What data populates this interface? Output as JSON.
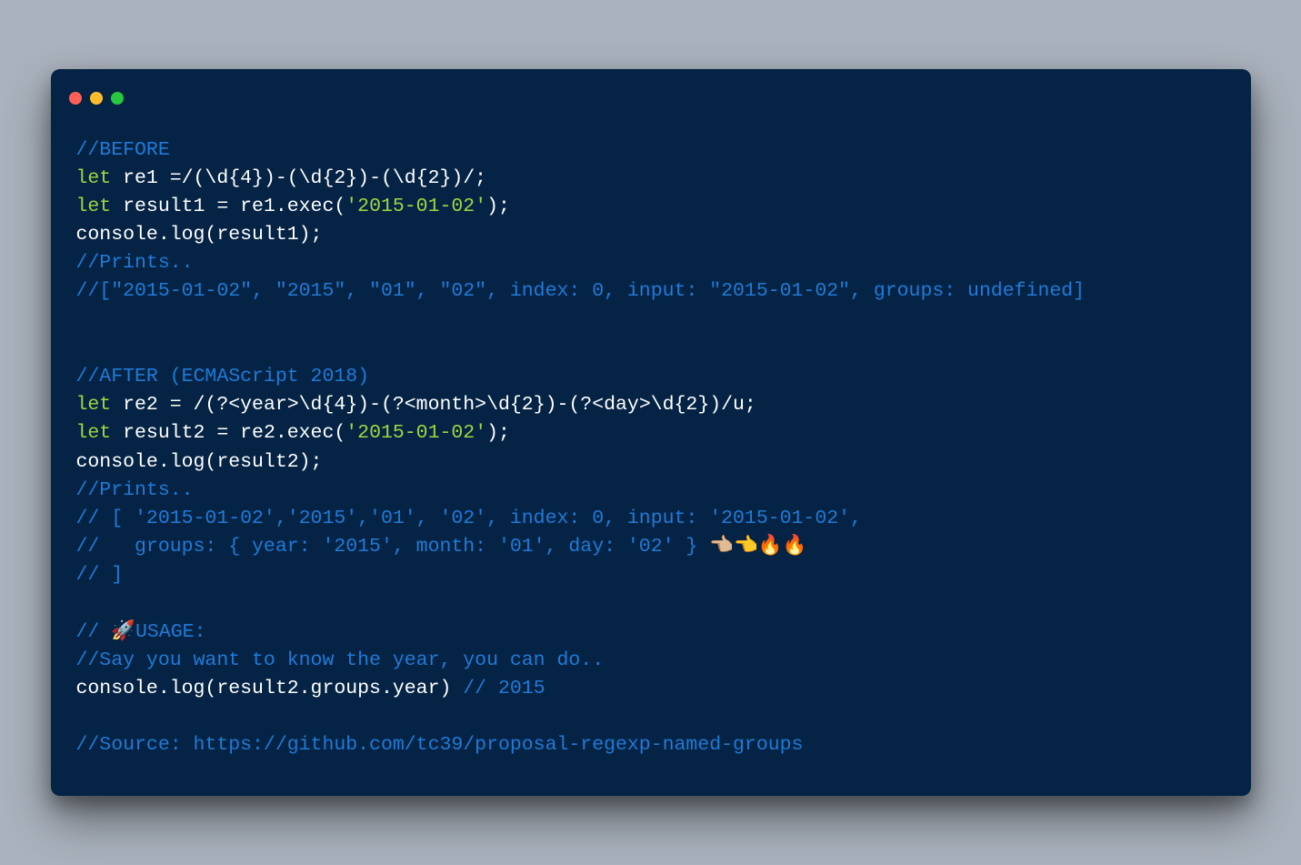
{
  "colors": {
    "background": "#aab2bd",
    "window": "#052445",
    "comment": "#1f7bd8",
    "keyword": "#9fd640",
    "string": "#9fd640",
    "plain": "#ffffff"
  },
  "traffic_lights": [
    "red",
    "yellow",
    "green"
  ],
  "code": {
    "lines": [
      [
        {
          "cls": "comment",
          "text": "//BEFORE"
        }
      ],
      [
        {
          "cls": "keyword",
          "text": "let"
        },
        {
          "cls": "plain",
          "text": " re1 =/(\\d{4})-(\\d{2})-(\\d{2})/;"
        }
      ],
      [
        {
          "cls": "keyword",
          "text": "let"
        },
        {
          "cls": "plain",
          "text": " result1 = re1.exec("
        },
        {
          "cls": "string",
          "text": "'2015-01-02'"
        },
        {
          "cls": "plain",
          "text": ");"
        }
      ],
      [
        {
          "cls": "plain",
          "text": "console.log(result1);"
        }
      ],
      [
        {
          "cls": "comment",
          "text": "//Prints.."
        }
      ],
      [
        {
          "cls": "comment",
          "text": "//[\"2015-01-02\", \"2015\", \"01\", \"02\", index: 0, input: \"2015-01-02\", groups: undefined]"
        }
      ],
      [
        {
          "cls": "plain",
          "text": ""
        }
      ],
      [
        {
          "cls": "plain",
          "text": ""
        }
      ],
      [
        {
          "cls": "comment",
          "text": "//AFTER (ECMAScript 2018)"
        }
      ],
      [
        {
          "cls": "keyword",
          "text": "let"
        },
        {
          "cls": "plain",
          "text": " re2 = /(?<year>\\d{4})-(?<month>\\d{2})-(?<day>\\d{2})/u;"
        }
      ],
      [
        {
          "cls": "keyword",
          "text": "let"
        },
        {
          "cls": "plain",
          "text": " result2 = re2.exec("
        },
        {
          "cls": "string",
          "text": "'2015-01-02'"
        },
        {
          "cls": "plain",
          "text": ");"
        }
      ],
      [
        {
          "cls": "plain",
          "text": "console.log(result2);"
        }
      ],
      [
        {
          "cls": "comment",
          "text": "//Prints.."
        }
      ],
      [
        {
          "cls": "comment",
          "text": "// [ '2015-01-02','2015','01', '02', index: 0, input: '2015-01-02',"
        }
      ],
      [
        {
          "cls": "comment",
          "text": "//   groups: { year: '2015', month: '01', day: '02' } "
        },
        {
          "cls": "plain",
          "text": "👈🏼👈🔥🔥"
        }
      ],
      [
        {
          "cls": "comment",
          "text": "// ]"
        }
      ],
      [
        {
          "cls": "plain",
          "text": ""
        }
      ],
      [
        {
          "cls": "comment",
          "text": "// "
        },
        {
          "cls": "plain",
          "text": "🚀"
        },
        {
          "cls": "comment",
          "text": "USAGE:"
        }
      ],
      [
        {
          "cls": "comment",
          "text": "//Say you want to know the year, you can do.."
        }
      ],
      [
        {
          "cls": "plain",
          "text": "console.log(result2.groups.year) "
        },
        {
          "cls": "comment",
          "text": "// 2015"
        }
      ],
      [
        {
          "cls": "plain",
          "text": ""
        }
      ],
      [
        {
          "cls": "comment",
          "text": "//Source: https://github.com/tc39/proposal-regexp-named-groups"
        }
      ]
    ]
  }
}
